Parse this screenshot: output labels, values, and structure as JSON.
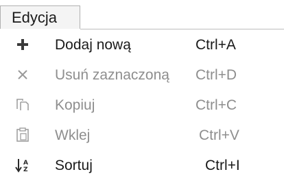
{
  "menu": {
    "title": "Edycja"
  },
  "items": [
    {
      "label": "Dodaj nową",
      "shortcut": "Ctrl+A",
      "enabled": true,
      "icon": "plus-icon"
    },
    {
      "label": "Usuń zaznaczoną",
      "shortcut": "Ctrl+D",
      "enabled": false,
      "icon": "delete-icon"
    },
    {
      "label": "Kopiuj",
      "shortcut": "Ctrl+C",
      "enabled": false,
      "icon": "copy-icon"
    },
    {
      "label": "Wklej",
      "shortcut": "Ctrl+V",
      "enabled": false,
      "icon": "paste-icon"
    },
    {
      "label": "Sortuj",
      "shortcut": "Ctrl+I",
      "enabled": true,
      "icon": "sort-icon"
    }
  ],
  "colors": {
    "enabled_text": "#1a1a1a",
    "disabled_text": "#8e8e8e",
    "header_bg": "#f4f4f4",
    "border": "#b0b0b0"
  }
}
